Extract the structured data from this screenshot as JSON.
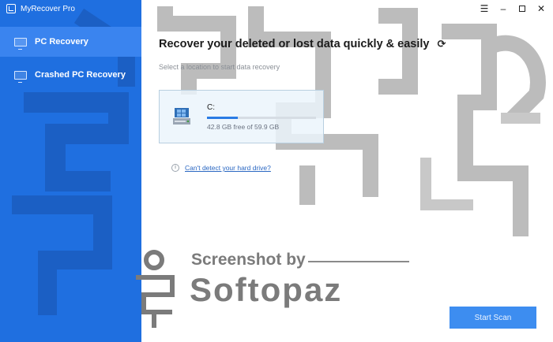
{
  "window": {
    "title": "MyRecover Pro",
    "controls": [
      "menu-icon",
      "minimize-icon",
      "maximize-icon",
      "close-icon"
    ]
  },
  "sidebar": {
    "items": [
      {
        "label": "PC Recovery",
        "icon": "monitor-icon",
        "active": true
      },
      {
        "label": "Crashed PC Recovery",
        "icon": "monitor-icon",
        "active": false
      }
    ]
  },
  "main": {
    "heading": "Recover your deleted or lost data quickly & easily",
    "subheading": "Select a location to start data recovery",
    "drive": {
      "label": "C:",
      "info": "42.8 GB free of 59.9 GB",
      "used_fraction": 0.285
    },
    "help_link": "Can't detect your hard drive?",
    "start_button": "Start Scan"
  },
  "watermark": {
    "line1": "Screenshot by",
    "line2": "Softopaz"
  },
  "colors": {
    "sidebar": "#1f6fe0",
    "active_item": "#3a84ef",
    "accent": "#2a7be4",
    "button": "#3d8df0"
  }
}
